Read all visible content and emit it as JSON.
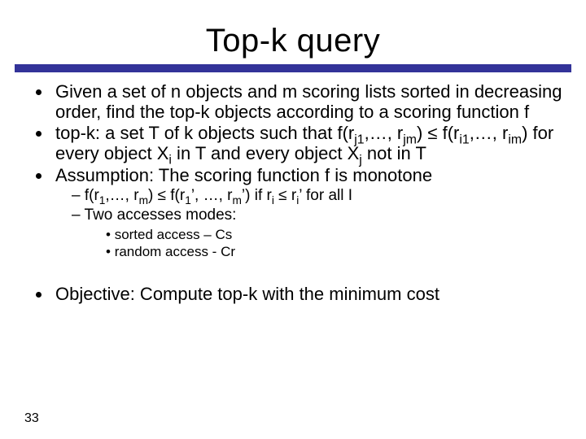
{
  "title": "Top-k query",
  "bullets": {
    "b1_pre": "Given a set of ",
    "b1_n": "n",
    "b1_mid1": " objects and ",
    "b1_m": "m",
    "b1_mid2": " scoring lists sorted in decreasing order, find the top-k objects according to a scoring function ",
    "b1_f": "f",
    "b2_label": "top-k",
    "b2_a": ": a set T of k objects such that f(r",
    "b2_j1": "j1",
    "b2_b": ",…, r",
    "b2_jm": "jm",
    "b2_c": ") ≤ f(r",
    "b2_i1": "i1",
    "b2_d": ",…, r",
    "b2_im": "im",
    "b2_e": ") for every object X",
    "b2_i": "i",
    "b2_f": " in T and every object X",
    "b2_j": "j",
    "b2_g": " not in T",
    "b3_pre": "Assumption: The scoring function ",
    "b3_f": "f",
    "b3_post": " is monotone",
    "s1_a": "f(r",
    "s1_1": "1",
    "s1_b": ",…, r",
    "s1_m": "m",
    "s1_c": ") ≤ f(r",
    "s1_1p": "1",
    "s1_d": "’, …, r",
    "s1_mp": "m",
    "s1_e": "’) if r",
    "s1_i": "i",
    "s1_f": " ≤ r",
    "s1_ip": "i",
    "s1_g": "’ for all I",
    "s2": "Two accesses modes:",
    "ss1": "sorted access – Cs",
    "ss2": "random access - Cr",
    "obj": "Objective: Compute top-k with the minimum cost"
  },
  "page": "33"
}
